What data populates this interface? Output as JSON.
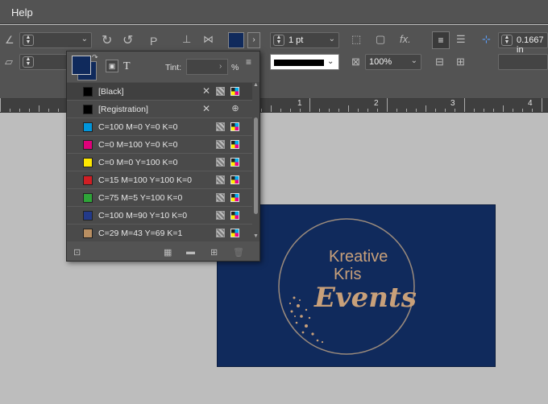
{
  "menubar": {
    "help_label": "Help"
  },
  "control_bar": {
    "stroke_weight": "1 pt",
    "opacity": "100%",
    "reference_value": "0.1667 in",
    "fx_label": "fx."
  },
  "ruler": {
    "labels": [
      "1",
      "2",
      "3",
      "4"
    ]
  },
  "swatches_panel": {
    "tint_label": "Tint:",
    "percent_label": "%",
    "text_icon_glyph": "T",
    "fill_color": "#102a5c",
    "items": [
      {
        "name": "[Black]",
        "color": "#000000"
      },
      {
        "name": "[Registration]",
        "color": "#000000"
      },
      {
        "name": "C=100 M=0 Y=0 K=0",
        "color": "#0096dc"
      },
      {
        "name": "C=0 M=100 Y=0 K=0",
        "color": "#e0007a"
      },
      {
        "name": "C=0 M=0 Y=100 K=0",
        "color": "#ffe800"
      },
      {
        "name": "C=15 M=100 Y=100 K=0",
        "color": "#d01e24"
      },
      {
        "name": "C=75 M=5 Y=100 K=0",
        "color": "#2ea538"
      },
      {
        "name": "C=100 M=90 Y=10 K=0",
        "color": "#233a8a"
      },
      {
        "name": "C=29 M=43 Y=69 K=1",
        "color": "#b98f62"
      }
    ]
  },
  "document": {
    "card_color": "#102a5c",
    "logo_line1": "Kreative",
    "logo_line2": "Kris",
    "logo_line3": "Events",
    "logo_color": "#c8a07a"
  }
}
